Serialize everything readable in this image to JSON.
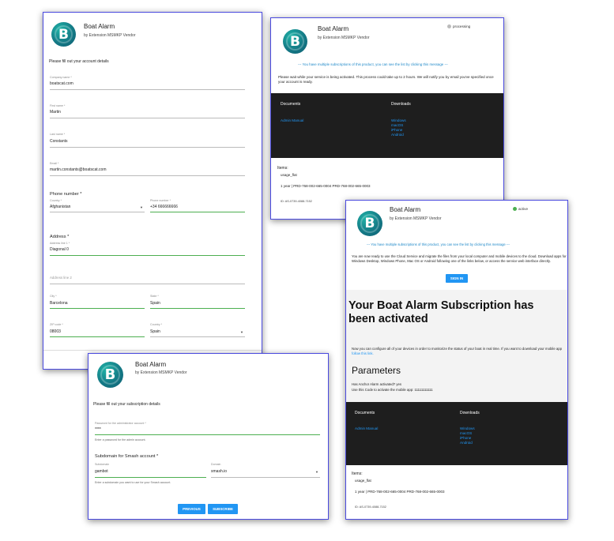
{
  "app": {
    "title": "Boat Alarm",
    "vendor": "by Extension MSMKP Vendor",
    "logo_letter": "B"
  },
  "colors": {
    "accent": "#2196f3",
    "frame": "#4a4adf",
    "active": "#4caf50",
    "dark_band": "#1e1e1e"
  },
  "account_form": {
    "intro": "Please fill out your account details",
    "company_label": "Company name *",
    "company_value": "boatscat.com",
    "first_label": "First name *",
    "first_value": "Martin",
    "last_label": "Last name *",
    "last_value": "Constants",
    "email_label": "Email *",
    "email_value": "martin.constants@boatscat.com",
    "phone_title": "Phone number *",
    "country_code_label": "Country *",
    "country_code_value": "Afghanistan",
    "phone_label": "Phone number *",
    "phone_value": "+34 666666666",
    "address_title": "Address *",
    "addr1_label": "Address line 1 *",
    "addr1_value": "Diagonal 0",
    "addr2_placeholder": "Address line 2",
    "city_label": "City *",
    "city_value": "Barcelona",
    "state_label": "State *",
    "state_value": "Spain",
    "zip_label": "ZIP code *",
    "zip_value": "08003",
    "country_label": "Country *",
    "country_value": "Spain"
  },
  "processing_panel": {
    "status": "processing",
    "notice": "--- You have multiple subscriptions of this product, you can see the list by clicking this message ---",
    "message": "Please wait while your service is being activated. This process could take up to 2 hours. We will notify you by email you've specified once your account is ready.",
    "documents_title": "Documents",
    "downloads_title": "Downloads",
    "documents": [
      "Admin Manual"
    ],
    "downloads": [
      "Windows",
      "macOS",
      "iPhone",
      "Android"
    ],
    "items_title": "Items:",
    "item_name": "usage_flat",
    "item_line": "1 year | PRD-768-002-665-0004 PRD-768-002-665-0003",
    "id_line": "ID: AS-0739-4088-7152"
  },
  "active_panel": {
    "status": "active",
    "notice": "--- You have multiple subscriptions of this product, you can see the list by clicking this message ---",
    "intro": "You are now ready to use the Cloud Service and migrate the files from your local computer and mobile devices to the cloud. Download apps for Windows Desktop, Windows Phone, Mac OS or Android following one of the links below, or access the service web interface directly.",
    "signin_label": "SIGN IN",
    "headline": "Your Boat Alarm Subscription has been activated",
    "configure_text": "Now you can configure all of your devices in order to monitorize the status of your boat in real time. If you want to download your mobile app",
    "configure_link": "follow this link.",
    "parameters_title": "Parameters",
    "param_1": "Has Anchor Alarm activated? yes",
    "param_2": "Use this Code to activate the mobile app: 11111111111",
    "documents_title": "Documents",
    "downloads_title": "Downloads",
    "documents": [
      "Admin Manual"
    ],
    "downloads": [
      "Windows",
      "macOS",
      "iPhone",
      "Android"
    ],
    "items_title": "Items:",
    "item_name": "usage_flat",
    "item_line": "1 year | PRD-768-002-665-0004 PRD-768-002-665-0003",
    "id_line": "ID: AS-0739-4088-7152"
  },
  "subscription_form": {
    "intro": "Please fill out your subscription details",
    "password_label": "Password for the administrator account *",
    "password_value": "****",
    "password_hint": "Enter a password for the admin account.",
    "subdomain_title": "Subdomain for Smash account *",
    "subdomain_label": "Subdomain",
    "subdomain_value": "gambot",
    "domain_label": "Domain",
    "domain_value": "smash.io",
    "subdomain_hint": "Enter a subdomain you want to use for your Smash account.",
    "previous_label": "PREVIOUS",
    "subscribe_label": "SUBSCRIBE"
  }
}
